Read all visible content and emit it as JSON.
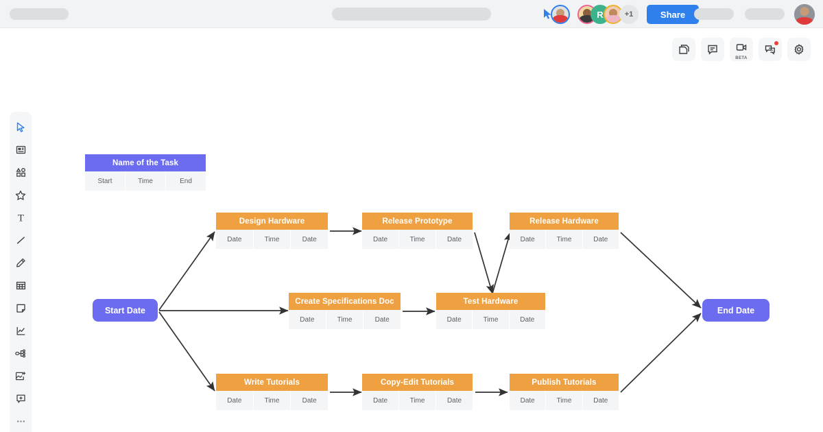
{
  "topbar": {
    "share_label": "Share",
    "overflow_count": "+1",
    "avatar_initial": "R",
    "placeholders": [
      "",
      "",
      "",
      ""
    ]
  },
  "right_icons": [
    {
      "name": "pages-icon",
      "label": ""
    },
    {
      "name": "comment-icon",
      "label": ""
    },
    {
      "name": "video-call-icon",
      "label": "BETA"
    },
    {
      "name": "chat-icon",
      "label": ""
    },
    {
      "name": "gear-icon",
      "label": ""
    }
  ],
  "left_toolbar": [
    {
      "name": "cursor-select-tool",
      "selected": true
    },
    {
      "name": "note-card-tool",
      "selected": false
    },
    {
      "name": "shapes-tool",
      "selected": false
    },
    {
      "name": "star-tool",
      "selected": false
    },
    {
      "name": "text-tool",
      "selected": false
    },
    {
      "name": "line-tool",
      "selected": false
    },
    {
      "name": "pencil-tool",
      "selected": false
    },
    {
      "name": "table-tool",
      "selected": false
    },
    {
      "name": "sticky-note-tool",
      "selected": false
    },
    {
      "name": "chart-tool",
      "selected": false
    },
    {
      "name": "mindmap-tool",
      "selected": false
    },
    {
      "name": "image-upload-tool",
      "selected": false
    },
    {
      "name": "frame-add-tool",
      "selected": false
    },
    {
      "name": "more-tools",
      "selected": false
    }
  ],
  "colors": {
    "task_header": "#efa141",
    "milestone": "#6c6cf0",
    "cell_bg": "#f4f5f6",
    "accent_blue": "#2f80ed",
    "canvas": "#ffffff"
  },
  "legend": {
    "title": "Name of the Task",
    "cells": [
      "Start",
      "Time",
      "End"
    ]
  },
  "diagram": {
    "start_node": "Start Date",
    "end_node": "End Date",
    "cell_labels": [
      "Date",
      "Time",
      "Date"
    ],
    "tasks": [
      {
        "id": "design-hardware",
        "title": "Design Hardware",
        "cells": [
          "Date",
          "Time",
          "Date"
        ]
      },
      {
        "id": "release-prototype",
        "title": "Release Prototype",
        "cells": [
          "Date",
          "Time",
          "Date"
        ]
      },
      {
        "id": "release-hardware",
        "title": "Release Hardware",
        "cells": [
          "Date",
          "Time",
          "Date"
        ]
      },
      {
        "id": "create-specifications",
        "title": "Create Specifications Doc",
        "cells": [
          "Date",
          "Time",
          "Date"
        ]
      },
      {
        "id": "test-hardware",
        "title": "Test Hardware",
        "cells": [
          "Date",
          "Time",
          "Date"
        ]
      },
      {
        "id": "write-tutorials",
        "title": "Write Tutorials",
        "cells": [
          "Date",
          "Time",
          "Date"
        ]
      },
      {
        "id": "copy-edit-tutorials",
        "title": "Copy-Edit Tutorials",
        "cells": [
          "Date",
          "Time",
          "Date"
        ]
      },
      {
        "id": "publish-tutorials",
        "title": "Publish Tutorials",
        "cells": [
          "Date",
          "Time",
          "Date"
        ]
      }
    ],
    "connections": [
      [
        "start-date",
        "design-hardware"
      ],
      [
        "start-date",
        "create-specifications"
      ],
      [
        "start-date",
        "write-tutorials"
      ],
      [
        "design-hardware",
        "release-prototype"
      ],
      [
        "release-prototype",
        "test-hardware"
      ],
      [
        "create-specifications",
        "test-hardware"
      ],
      [
        "test-hardware",
        "release-hardware"
      ],
      [
        "write-tutorials",
        "copy-edit-tutorials"
      ],
      [
        "copy-edit-tutorials",
        "publish-tutorials"
      ],
      [
        "release-hardware",
        "end-date"
      ],
      [
        "publish-tutorials",
        "end-date"
      ]
    ]
  }
}
